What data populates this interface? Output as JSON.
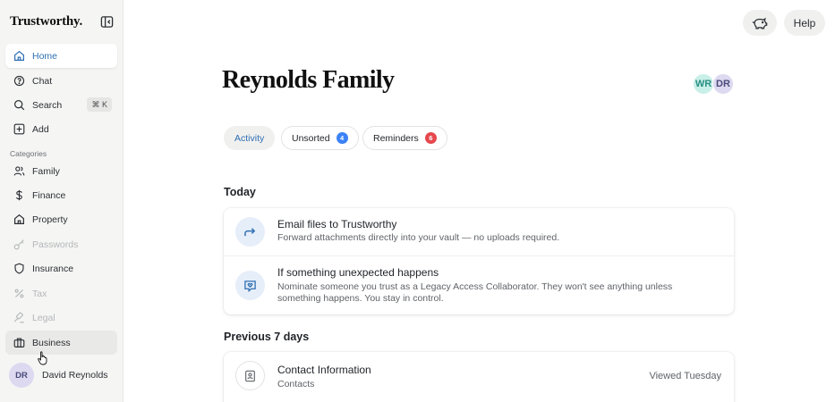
{
  "app": {
    "brand": "Trustworthy."
  },
  "sidebar": {
    "items": [
      {
        "label": "Home",
        "icon": "home-icon",
        "state": "active"
      },
      {
        "label": "Chat",
        "icon": "chat-icon"
      },
      {
        "label": "Search",
        "icon": "search-icon",
        "shortcut": "⌘ K"
      },
      {
        "label": "Add",
        "icon": "plus-square-icon"
      }
    ],
    "categories_label": "Categories",
    "categories": [
      {
        "label": "Family",
        "icon": "people-icon"
      },
      {
        "label": "Finance",
        "icon": "dollar-icon"
      },
      {
        "label": "Property",
        "icon": "house-icon"
      },
      {
        "label": "Passwords",
        "icon": "key-icon",
        "state": "disabled"
      },
      {
        "label": "Insurance",
        "icon": "shield-icon"
      },
      {
        "label": "Tax",
        "icon": "percent-icon",
        "state": "disabled"
      },
      {
        "label": "Legal",
        "icon": "gavel-icon",
        "state": "disabled"
      },
      {
        "label": "Business",
        "icon": "briefcase-icon",
        "state": "hover"
      }
    ],
    "user": {
      "initials": "DR",
      "name": "David Reynolds"
    }
  },
  "header": {
    "help_label": "Help",
    "piggy_icon": "piggy-bank-icon"
  },
  "main": {
    "title": "Reynolds Family",
    "members": [
      {
        "initials": "WR",
        "color": "#c9efe9",
        "text_color": "#2a8f84"
      },
      {
        "initials": "DR",
        "color": "#dcd9f0",
        "text_color": "#4b4a7a"
      }
    ],
    "tabs": [
      {
        "label": "Activity",
        "active": true
      },
      {
        "label": "Unsorted",
        "badge": "4",
        "badge_color": "#3b82f6"
      },
      {
        "label": "Reminders",
        "badge": "6",
        "badge_color": "#e5484d"
      }
    ],
    "today_heading": "Today",
    "today": [
      {
        "title": "Email files to Trustworthy",
        "subtitle": "Forward attachments directly into your vault — no uploads required.",
        "icon": "forward-arrow-icon"
      },
      {
        "title": "If something unexpected happens",
        "subtitle": "Nominate someone you trust as a Legacy Access Collaborator. They won't see anything unless something happens. You stay in control.",
        "icon": "heart-message-icon"
      }
    ],
    "previous_heading": "Previous 7 days",
    "previous": [
      {
        "title": "Contact Information",
        "subtitle": "Contacts",
        "meta": "Viewed Tuesday",
        "icon": "contact-card-icon"
      }
    ]
  },
  "colors": {
    "accent": "#2f6fb3",
    "sidebar_bg": "#f5f5f4",
    "icon_bg": "#e6eef9"
  }
}
